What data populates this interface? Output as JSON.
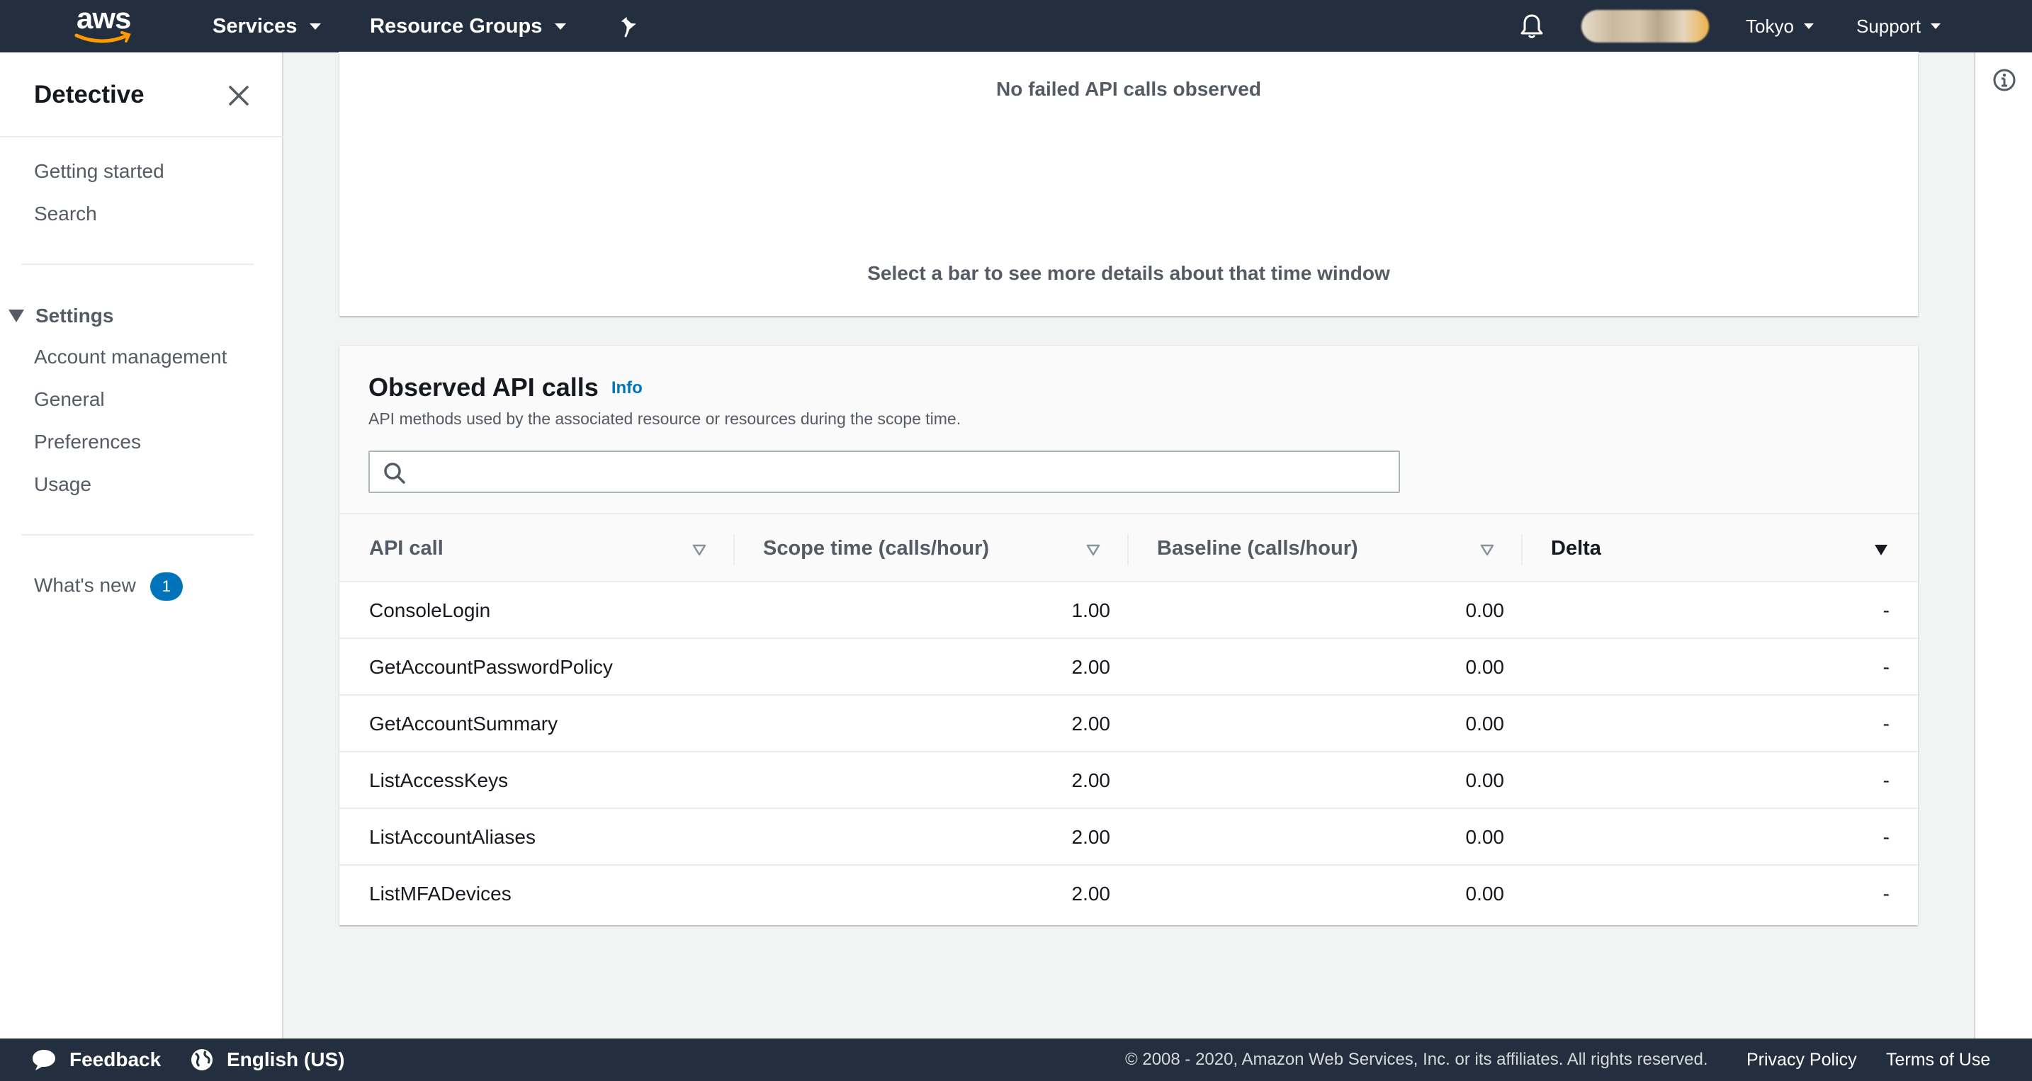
{
  "topnav": {
    "logo_text": "aws",
    "services_label": "Services",
    "resource_groups_label": "Resource Groups",
    "region_label": "Tokyo",
    "support_label": "Support"
  },
  "sidebar": {
    "title": "Detective",
    "items_top": [
      {
        "label": "Getting started"
      },
      {
        "label": "Search"
      }
    ],
    "settings_label": "Settings",
    "settings_items": [
      {
        "label": "Account management"
      },
      {
        "label": "General"
      },
      {
        "label": "Preferences"
      },
      {
        "label": "Usage"
      }
    ],
    "whats_new_label": "What's new",
    "whats_new_count": "1"
  },
  "failed_calls_panel": {
    "empty_message": "No failed API calls observed",
    "hint": "Select a bar to see more details about that time window"
  },
  "observed_api_calls": {
    "title": "Observed API calls",
    "info_label": "Info",
    "description": "API methods used by the associated resource or resources during the scope time.",
    "search_placeholder": "",
    "columns": [
      "API call",
      "Scope time (calls/hour)",
      "Baseline (calls/hour)",
      "Delta"
    ],
    "sorted_column": "Delta",
    "rows": [
      {
        "api_call": "ConsoleLogin",
        "scope": "1.00",
        "baseline": "0.00",
        "delta": "-"
      },
      {
        "api_call": "GetAccountPasswordPolicy",
        "scope": "2.00",
        "baseline": "0.00",
        "delta": "-"
      },
      {
        "api_call": "GetAccountSummary",
        "scope": "2.00",
        "baseline": "0.00",
        "delta": "-"
      },
      {
        "api_call": "ListAccessKeys",
        "scope": "2.00",
        "baseline": "0.00",
        "delta": "-"
      },
      {
        "api_call": "ListAccountAliases",
        "scope": "2.00",
        "baseline": "0.00",
        "delta": "-"
      },
      {
        "api_call": "ListMFADevices",
        "scope": "2.00",
        "baseline": "0.00",
        "delta": "-"
      }
    ]
  },
  "footer": {
    "feedback_label": "Feedback",
    "language_label": "English (US)",
    "copyright": "© 2008 - 2020, Amazon Web Services, Inc. or its affiliates. All rights reserved.",
    "privacy_label": "Privacy Policy",
    "terms_label": "Terms of Use"
  },
  "colors": {
    "nav_bg": "#232f3e",
    "link_blue": "#0073bb",
    "aws_orange": "#ff9900"
  },
  "icons": [
    "aws-logo-icon",
    "pin-icon",
    "bell-icon",
    "close-icon",
    "caret-down-icon",
    "info-icon",
    "search-icon",
    "sort-icon",
    "chat-bubble-icon",
    "globe-icon"
  ]
}
